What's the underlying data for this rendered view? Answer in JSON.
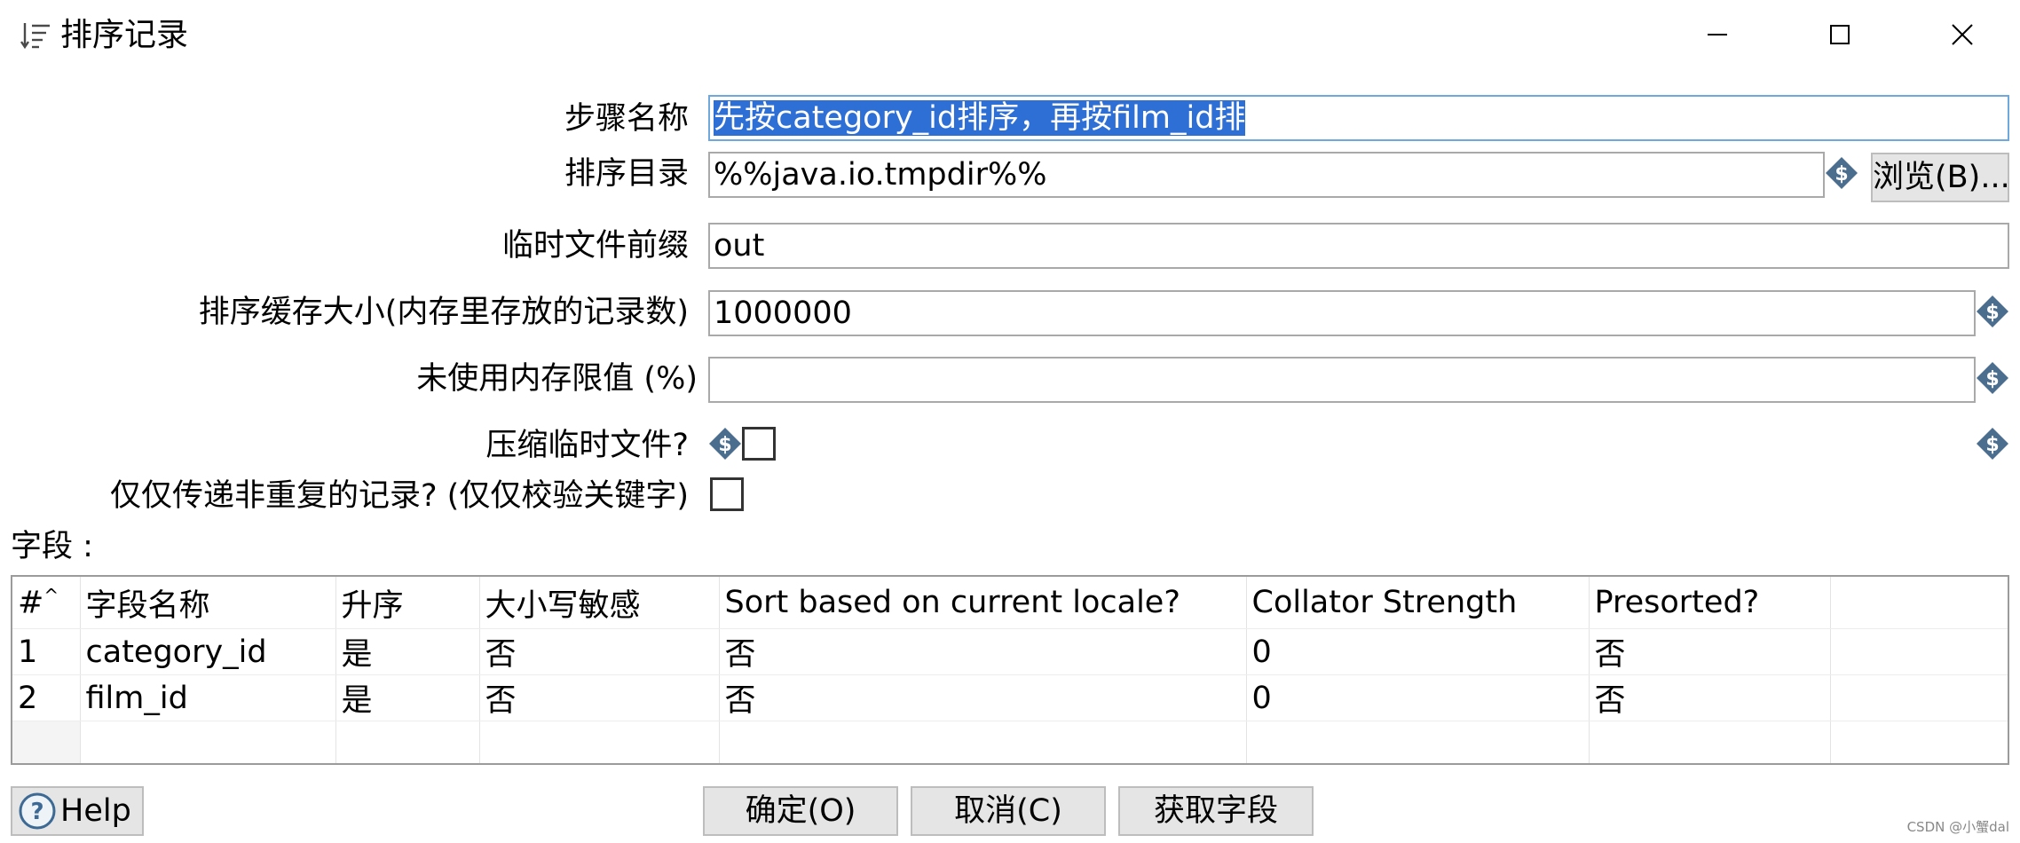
{
  "window": {
    "title": "排序记录",
    "icon": "sort-list-icon",
    "minimize_icon": "minimize-icon",
    "maximize_icon": "maximize-icon",
    "close_icon": "close-icon"
  },
  "form": {
    "step_name": {
      "label": "步骤名称",
      "value": "先按category_id排序，再按film_id排"
    },
    "sort_dir": {
      "label": "排序目录",
      "value": "%%java.io.tmpdir%%",
      "browse_label": "浏览(B)..."
    },
    "temp_prefix": {
      "label": "临时文件前缀",
      "value": "out"
    },
    "sort_size": {
      "label": "排序缓存大小(内存里存放的记录数)",
      "value": "1000000"
    },
    "free_memory": {
      "label": "未使用内存限值 (%)",
      "value": ""
    },
    "compress": {
      "label": "压缩临时文件?",
      "checked": false
    },
    "unique_rows": {
      "label": "仅仅传递非重复的记录? (仅仅校验关键字)",
      "checked": false
    }
  },
  "fields": {
    "label": "字段 :",
    "columns": [
      "#",
      "字段名称",
      "升序",
      "大小写敏感",
      "Sort based on current locale?",
      "Collator Strength",
      "Presorted?"
    ],
    "rows": [
      {
        "num": "1",
        "name": "category_id",
        "asc": "是",
        "case": "否",
        "locale": "否",
        "strength": "0",
        "presorted": "否"
      },
      {
        "num": "2",
        "name": "film_id",
        "asc": "是",
        "case": "否",
        "locale": "否",
        "strength": "0",
        "presorted": "否"
      }
    ]
  },
  "buttons": {
    "help": "Help",
    "ok": "确定(O)",
    "cancel": "取消(C)",
    "get_fields": "获取字段"
  },
  "watermark": "CSDN @小蟹dal",
  "colors": {
    "selection": "#2e6fd6",
    "variable_icon": "#4b6e8f",
    "button_bg": "#e5e5e5"
  }
}
